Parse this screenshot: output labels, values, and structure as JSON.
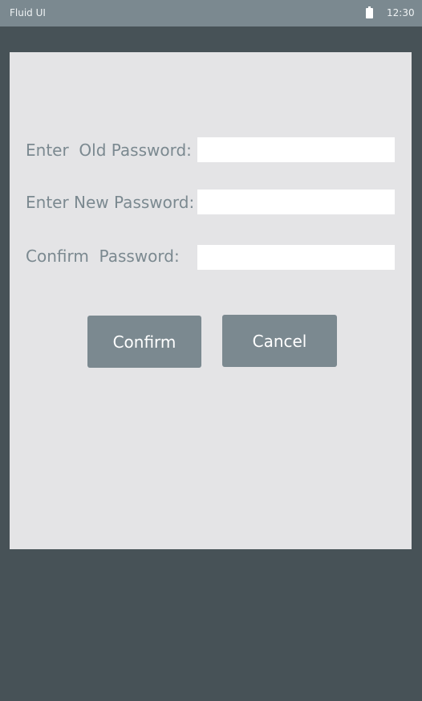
{
  "status_bar": {
    "app_title": "Fluid UI",
    "battery_icon": "battery-icon",
    "time": "12:30"
  },
  "form": {
    "old_password": {
      "label": "Enter  Old Password:",
      "value": "",
      "placeholder": ""
    },
    "new_password": {
      "label": "Enter New Password:",
      "value": "",
      "placeholder": ""
    },
    "confirm_password": {
      "label": "Confirm  Password:",
      "value": "",
      "placeholder": ""
    }
  },
  "actions": {
    "confirm_label": "Confirm",
    "cancel_label": "Cancel"
  },
  "colors": {
    "background": "#475257",
    "status_bar": "#7b8990",
    "panel": "#e4e4e6",
    "label_text": "#7b8990",
    "button": "#7b8990",
    "button_text": "#ffffff",
    "field": "#ffffff"
  }
}
